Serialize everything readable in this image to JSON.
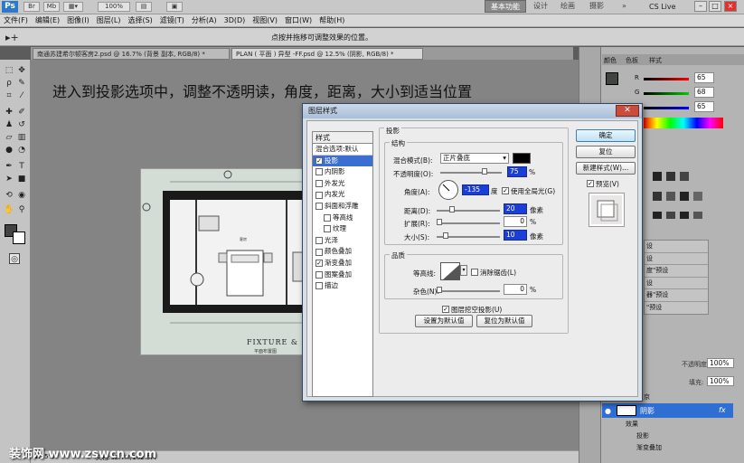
{
  "app": {
    "logo": "Ps",
    "zoom_display": "100%"
  },
  "workspace_buttons": [
    "基本功能",
    "设计",
    "绘画",
    "摄影"
  ],
  "cslive": "CS Live",
  "menu": [
    "文件(F)",
    "编辑(E)",
    "图像(I)",
    "图层(L)",
    "选择(S)",
    "滤镜(T)",
    "分析(A)",
    "3D(D)",
    "视图(V)",
    "窗口(W)",
    "帮助(H)"
  ],
  "options_hint": "点按并拖移可调整效果的位置。",
  "tabs": [
    {
      "label": "南通苏建希尔顿客房2.psd @ 16.7% (背景 副本, RGB/8) *",
      "active": false
    },
    {
      "label": "PLAN ( 平面 ) 异型 -FF.psd @ 12.5% (阴影, RGB/8) *",
      "active": true
    }
  ],
  "overlay_text": "进入到投影选项中，调整不透明读，角度，距离，大小到适当位置",
  "drawing": {
    "title_line1": "FIXTURE & FU",
    "title_line2": "平面布置图",
    "room_label": "客房"
  },
  "status": {
    "zoom": "12.5%",
    "doc": "文档:32.7M/162.9M"
  },
  "right_panel": {
    "color_tabs": [
      "颜色",
      "色板",
      "样式"
    ],
    "rgb": [
      {
        "label": "R",
        "value": "65"
      },
      {
        "label": "G",
        "value": "68"
      },
      {
        "label": "B",
        "value": "65"
      }
    ],
    "adjust_items": [
      "设",
      "设",
      "度\"预设",
      "设",
      "器\"预设",
      "\"预设"
    ],
    "layers": {
      "opacity_label": "不透明度:",
      "opacity": "100%",
      "fill_label": "填充:",
      "fill": "100%",
      "layer_name": "阴影",
      "effects": "效果",
      "effect_items": [
        "投影",
        "渐变叠加"
      ],
      "bg_label": "京"
    }
  },
  "dialog": {
    "title": "图层样式",
    "styles_header": "样式",
    "blend_default": "混合选项:默认",
    "style_items": [
      {
        "label": "投影",
        "checked": true,
        "selected": true,
        "indent": false
      },
      {
        "label": "内阴影",
        "checked": false,
        "selected": false,
        "indent": false
      },
      {
        "label": "外发光",
        "checked": false,
        "selected": false,
        "indent": false
      },
      {
        "label": "内发光",
        "checked": false,
        "selected": false,
        "indent": false
      },
      {
        "label": "斜面和浮雕",
        "checked": false,
        "selected": false,
        "indent": false
      },
      {
        "label": "等高线",
        "checked": false,
        "selected": false,
        "indent": true
      },
      {
        "label": "纹理",
        "checked": false,
        "selected": false,
        "indent": true
      },
      {
        "label": "光泽",
        "checked": false,
        "selected": false,
        "indent": false
      },
      {
        "label": "颜色叠加",
        "checked": false,
        "selected": false,
        "indent": false
      },
      {
        "label": "渐变叠加",
        "checked": true,
        "selected": false,
        "indent": false
      },
      {
        "label": "图案叠加",
        "checked": false,
        "selected": false,
        "indent": false
      },
      {
        "label": "描边",
        "checked": false,
        "selected": false,
        "indent": false
      }
    ],
    "section_title": "投影",
    "structure_title": "结构",
    "blend_mode_label": "混合模式(B):",
    "blend_mode_value": "正片叠底",
    "opacity_label": "不透明度(O):",
    "opacity_value": "75",
    "percent": "%",
    "angle_label": "角度(A):",
    "angle_value": "-135",
    "degree": "度",
    "global_light_label": "使用全局光(G)",
    "distance_label": "距离(D):",
    "distance_value": "20",
    "spread_label": "扩展(R):",
    "spread_value": "0",
    "size_label": "大小(S):",
    "size_value": "10",
    "px": "像素",
    "quality_title": "品质",
    "contour_label": "等高线:",
    "antialias_label": "消除锯齿(L)",
    "noise_label": "杂色(N):",
    "noise_value": "0",
    "knockout_label": "图层挖空投影(U)",
    "set_default": "设置为默认值",
    "reset_default": "复位为默认值",
    "ok": "确定",
    "cancel": "复位",
    "new_style": "新建样式(W)...",
    "preview_label": "预览(V)",
    "shadow_color": "#000000"
  },
  "watermark": "装饰网 www.zswcn.com"
}
